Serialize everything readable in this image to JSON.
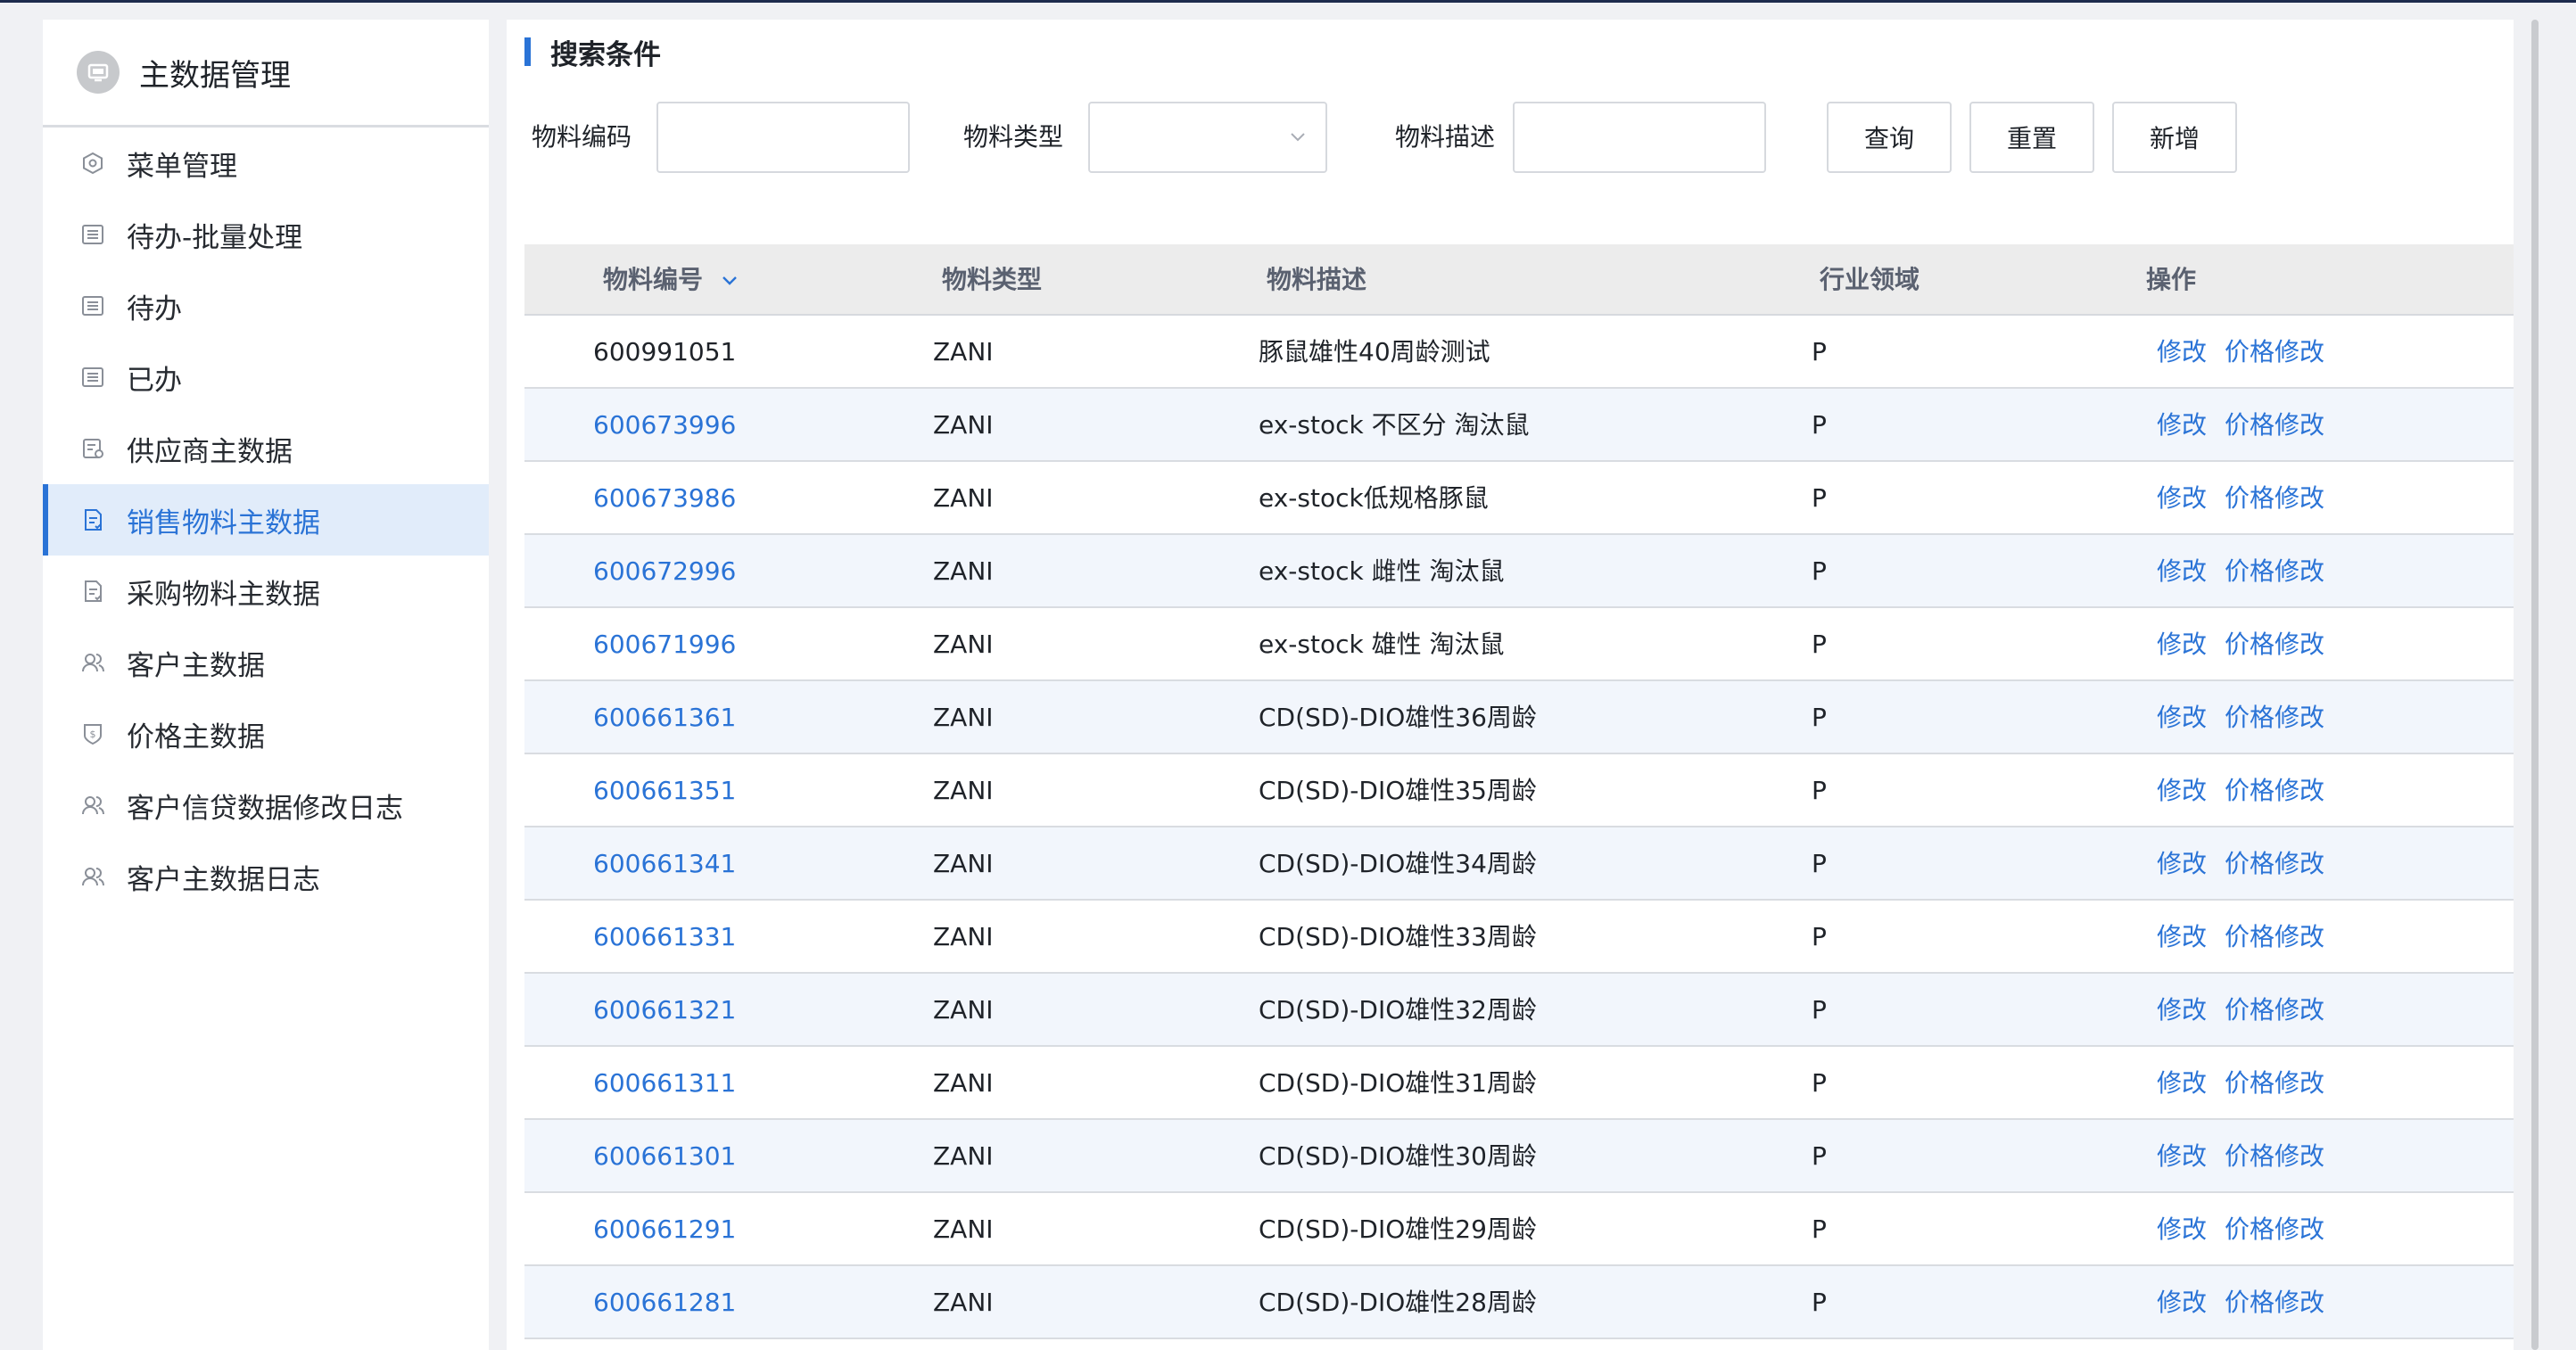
{
  "sidebar": {
    "title": "主数据管理",
    "items": [
      {
        "label": "菜单管理",
        "icon": "hexagon-settings-icon"
      },
      {
        "label": "待办-批量处理",
        "icon": "list-icon"
      },
      {
        "label": "待办",
        "icon": "list-icon"
      },
      {
        "label": "已办",
        "icon": "list-icon"
      },
      {
        "label": "供应商主数据",
        "icon": "supplier-doc-icon"
      },
      {
        "label": "销售物料主数据",
        "icon": "document-icon"
      },
      {
        "label": "采购物料主数据",
        "icon": "document-icon"
      },
      {
        "label": "客户主数据",
        "icon": "users-icon"
      },
      {
        "label": "价格主数据",
        "icon": "price-shield-icon"
      },
      {
        "label": "客户信贷数据修改日志",
        "icon": "users-icon"
      },
      {
        "label": "客户主数据日志",
        "icon": "users-icon"
      }
    ],
    "active_index": 5
  },
  "search": {
    "title": "搜索条件",
    "code_label": "物料编码",
    "code_value": "",
    "type_label": "物料类型",
    "type_value": "",
    "desc_label": "物料描述",
    "desc_value": "",
    "query_button": "查询",
    "reset_button": "重置",
    "add_button": "新增"
  },
  "table": {
    "headers": {
      "code": "物料编号",
      "type": "物料类型",
      "desc": "物料描述",
      "industry": "行业领域",
      "action": "操作"
    },
    "edit_label": "修改",
    "price_edit_label": "价格修改",
    "rows": [
      {
        "code": "600991051",
        "type": "ZANI",
        "desc": "豚鼠雄性40周龄测试",
        "industry": "P"
      },
      {
        "code": "600673996",
        "type": "ZANI",
        "desc": "ex-stock 不区分 淘汰鼠",
        "industry": "P"
      },
      {
        "code": "600673986",
        "type": "ZANI",
        "desc": "ex-stock低规格豚鼠",
        "industry": "P"
      },
      {
        "code": "600672996",
        "type": "ZANI",
        "desc": "ex-stock 雌性 淘汰鼠",
        "industry": "P"
      },
      {
        "code": "600671996",
        "type": "ZANI",
        "desc": "ex-stock 雄性 淘汰鼠",
        "industry": "P"
      },
      {
        "code": "600661361",
        "type": "ZANI",
        "desc": "CD(SD)-DIO雄性36周龄",
        "industry": "P"
      },
      {
        "code": "600661351",
        "type": "ZANI",
        "desc": "CD(SD)-DIO雄性35周龄",
        "industry": "P"
      },
      {
        "code": "600661341",
        "type": "ZANI",
        "desc": "CD(SD)-DIO雄性34周龄",
        "industry": "P"
      },
      {
        "code": "600661331",
        "type": "ZANI",
        "desc": "CD(SD)-DIO雄性33周龄",
        "industry": "P"
      },
      {
        "code": "600661321",
        "type": "ZANI",
        "desc": "CD(SD)-DIO雄性32周龄",
        "industry": "P"
      },
      {
        "code": "600661311",
        "type": "ZANI",
        "desc": "CD(SD)-DIO雄性31周龄",
        "industry": "P"
      },
      {
        "code": "600661301",
        "type": "ZANI",
        "desc": "CD(SD)-DIO雄性30周龄",
        "industry": "P"
      },
      {
        "code": "600661291",
        "type": "ZANI",
        "desc": "CD(SD)-DIO雄性29周龄",
        "industry": "P"
      },
      {
        "code": "600661281",
        "type": "ZANI",
        "desc": "CD(SD)-DIO雄性28周龄",
        "industry": "P"
      }
    ]
  },
  "colors": {
    "accent": "#2a73d6",
    "active_bg": "#e1ecfa",
    "row_alt_bg": "#f2f6fc",
    "header_bg": "#ececec"
  }
}
